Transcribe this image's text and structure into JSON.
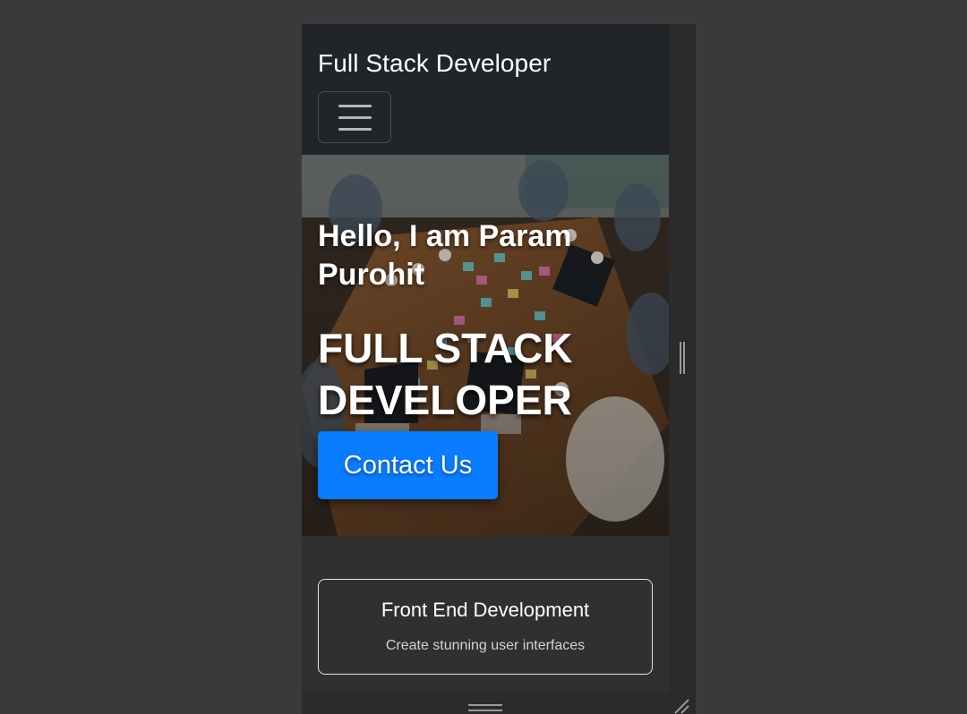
{
  "navbar": {
    "brand": "Full Stack Developer",
    "toggler_icon": "hamburger-icon"
  },
  "hero": {
    "greeting": "Hello, I am Param Purohit",
    "title": "FULL STACK DEVELOPER",
    "contact_label": "Contact Us",
    "contact_color": "#0a7cff"
  },
  "services": [
    {
      "title": "Front End Development",
      "text": "Create stunning user interfaces"
    }
  ],
  "devtools": {
    "side_handle_icon": "resize-handle-icon",
    "bottom_handle_icon": "resize-handle-icon",
    "corner_icon": "resize-corner-icon"
  }
}
